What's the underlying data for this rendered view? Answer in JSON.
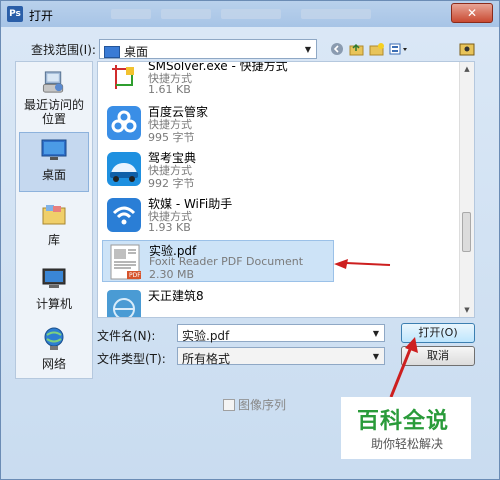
{
  "window": {
    "title": "打开",
    "app_icon": "Ps",
    "close_label": "✕"
  },
  "lookin": {
    "label": "查找范围(I):",
    "value": "桌面",
    "toolbar_icons": [
      "back-icon",
      "up-folder-icon",
      "new-folder-icon",
      "view-menu-icon"
    ]
  },
  "places": [
    {
      "label": "最近访问的位置",
      "icon": "recent-places-icon"
    },
    {
      "label": "桌面",
      "icon": "desktop-icon",
      "selected": true
    },
    {
      "label": "库",
      "icon": "libraries-icon"
    },
    {
      "label": "计算机",
      "icon": "computer-icon"
    },
    {
      "label": "网络",
      "icon": "network-icon"
    }
  ],
  "files": [
    {
      "name": "SMSolver.exe - 快捷方式",
      "type": "快捷方式",
      "size": "1.61 KB",
      "icon": "smsolver-icon"
    },
    {
      "name": "百度云管家",
      "type": "快捷方式",
      "size": "995 字节",
      "icon": "baidu-cloud-icon"
    },
    {
      "name": "驾考宝典",
      "type": "快捷方式",
      "size": "992 字节",
      "icon": "jiakao-car-icon"
    },
    {
      "name": "软媒 - WiFi助手",
      "type": "快捷方式",
      "size": "1.93 KB",
      "icon": "wifi-icon"
    },
    {
      "name": "实验.pdf",
      "type": "Foxit Reader PDF Document",
      "size": "2.30 MB",
      "icon": "pdf-icon",
      "selected": true
    },
    {
      "name": "天正建筑8",
      "type": "",
      "size": "",
      "icon": "tangent-icon"
    }
  ],
  "filename": {
    "label": "文件名(N):",
    "value": "实验.pdf"
  },
  "filetype": {
    "label": "文件类型(T):",
    "value": "所有格式"
  },
  "buttons": {
    "open": "打开(O)",
    "cancel": "取消"
  },
  "image_sequence": {
    "label": "图像序列",
    "checked": false
  },
  "watermark": {
    "title": "百科全说",
    "subtitle": "助你轻松解决"
  },
  "colors": {
    "accent": "#cd1f1f",
    "watermark_green": "#2a9b3a",
    "selection": "#cde3f7"
  }
}
